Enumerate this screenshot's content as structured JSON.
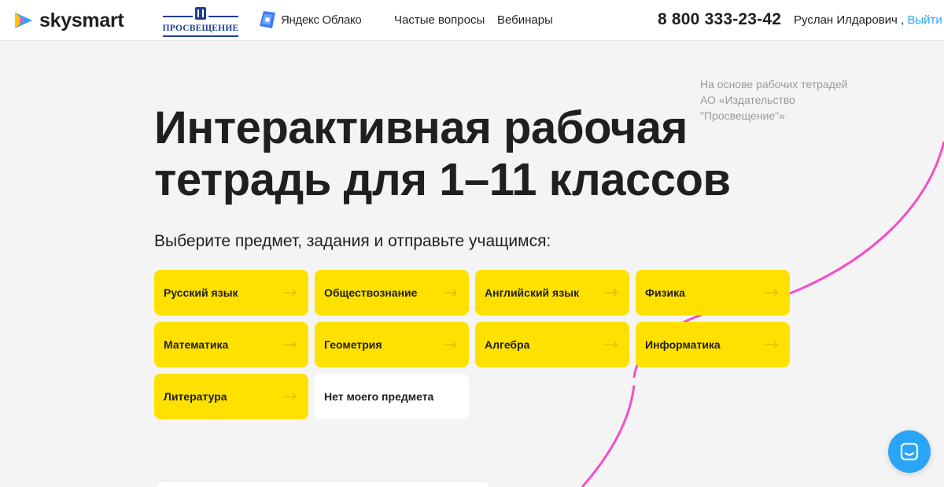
{
  "header": {
    "brand_logo": "skysmart",
    "partner_logo_1": "ПРОСВЕЩЕНИЕ",
    "partner_logo_2": "Яндекс Облако",
    "nav": [
      {
        "label": "Частые вопросы"
      },
      {
        "label": "Вебинары"
      }
    ],
    "phone": "8 800 333-23-42",
    "user_name": "Руслан Илдарович ,",
    "logout_label": "Выйти"
  },
  "side_note": "На основе рабочих тетрадей АО «Издательство \"Просвещение\"»",
  "hero": {
    "title": "Интерактивная рабочая тетрадь для 1–11 классов",
    "subtitle": "Выберите предмет, задания и отправьте учащимся:"
  },
  "subjects": [
    {
      "label": "Русский язык"
    },
    {
      "label": "Обществознание"
    },
    {
      "label": "Английский язык"
    },
    {
      "label": "Физика"
    },
    {
      "label": "Математика"
    },
    {
      "label": "Геометрия"
    },
    {
      "label": "Алгебра"
    },
    {
      "label": "Информатика"
    },
    {
      "label": "Литература"
    },
    {
      "label": "Нет моего предмета"
    }
  ],
  "colors": {
    "accent_yellow": "#ffe100",
    "link_blue": "#2aa4f4",
    "decor_pink": "#f54ec8",
    "background": "#f4f4f4"
  },
  "icons": {
    "arrow": "arrow-right-icon",
    "chat": "chat-icon"
  }
}
